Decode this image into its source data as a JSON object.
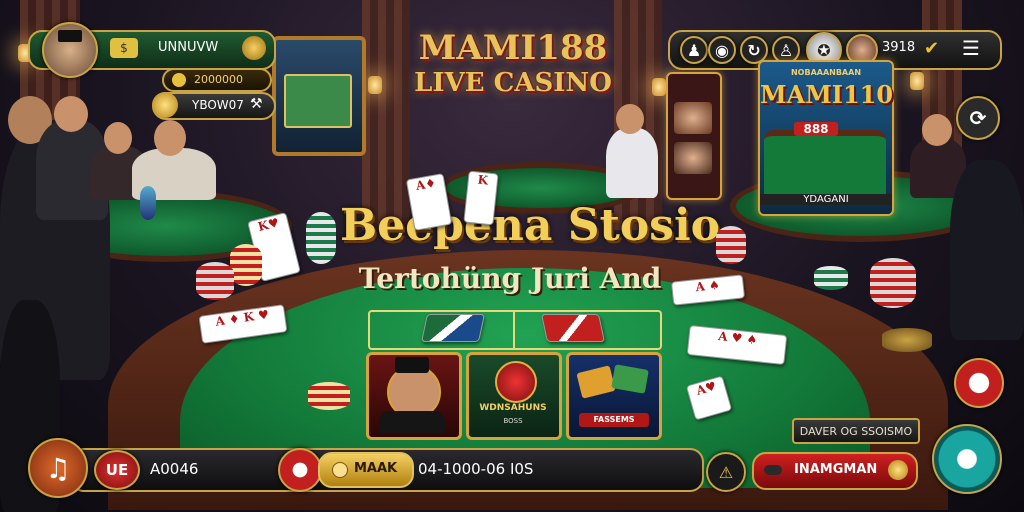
{
  "brand": {
    "line1": "MAMI188",
    "line2": "LIVE CASINO"
  },
  "headline": {
    "title": "Beepena Stosio",
    "subtitle": "Tertohüng Juri And"
  },
  "player_panel": {
    "name": "UNNUVW",
    "balance": "2000000",
    "bonus": "YBOW07"
  },
  "top_right": {
    "score": "3918"
  },
  "side_screen": {
    "title": "MAMI110",
    "header": "NOBAAANBAAN",
    "chip_label": "888",
    "caption": "YDAGANI"
  },
  "tiles": [
    {
      "title": "",
      "label": ""
    },
    {
      "title": "WDNSAHUNS",
      "label": "BOSS"
    },
    {
      "title": "",
      "label": "FASSEMS"
    }
  ],
  "bottom_bar": {
    "code": "UE",
    "amount": "A0046",
    "bet_label": "MAAK",
    "ticker": "04-1000-06 I0S",
    "action_label": "INAMGMAN",
    "info_label": "DAVER OG SSOISMO"
  },
  "colors": {
    "gold": "#c9a445",
    "felt": "#137a3a",
    "red": "#c21f1f",
    "teal": "#19a5a0"
  }
}
